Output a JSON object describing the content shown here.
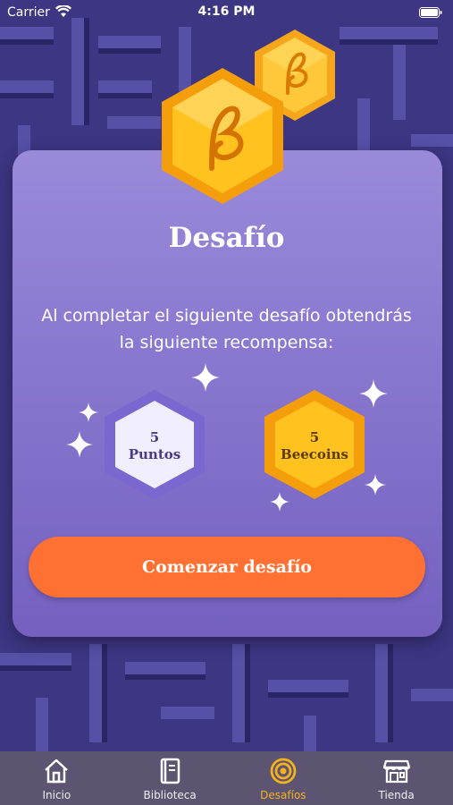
{
  "status_bar": {
    "carrier": "Carrier",
    "time": "4:16 PM"
  },
  "challenge": {
    "title": "Desafío",
    "description": "Al completar el siguiente desafío obtendrás la siguiente recompensa:",
    "rewards": [
      {
        "amount": "5",
        "label": "Puntos",
        "color": "#7a68d0"
      },
      {
        "amount": "5",
        "label": "Beecoins",
        "color": "#f6b21b"
      }
    ],
    "start_button": "Comenzar desafío"
  },
  "tab_bar": {
    "tabs": [
      {
        "label": "Inicio",
        "icon": "home-icon"
      },
      {
        "label": "Biblioteca",
        "icon": "book-icon"
      },
      {
        "label": "Desafíos",
        "icon": "target-icon",
        "active": true
      },
      {
        "label": "Tienda",
        "icon": "store-icon"
      }
    ],
    "active_color": "#f6b21b"
  },
  "colors": {
    "accent": "#ff7133",
    "card": "#8a79d0",
    "tab_bar": "#5d5471"
  }
}
